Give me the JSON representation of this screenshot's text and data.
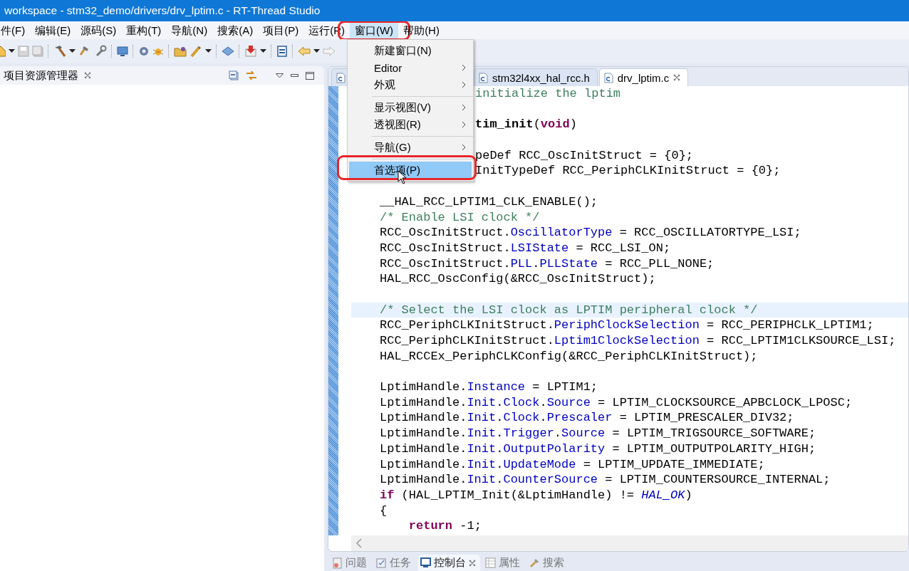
{
  "window": {
    "title": "workspace - stm32_demo/drivers/drv_lptim.c - RT-Thread Studio"
  },
  "menu_bar": [
    {
      "label": "件(F)",
      "selected": false
    },
    {
      "label": "编辑(E)",
      "selected": false
    },
    {
      "label": "源码(S)",
      "selected": false
    },
    {
      "label": "重构(T)",
      "selected": false
    },
    {
      "label": "导航(N)",
      "selected": false
    },
    {
      "label": "搜索(A)",
      "selected": false
    },
    {
      "label": "项目(P)",
      "selected": false
    },
    {
      "label": "运行(R)",
      "selected": false
    },
    {
      "label": "窗口(W)",
      "selected": true,
      "circled": true
    },
    {
      "label": "帮助(H)",
      "selected": false
    }
  ],
  "window_menu": [
    {
      "kind": "item",
      "label": "新建窗口(N)",
      "submenu": false,
      "selected": false
    },
    {
      "kind": "item",
      "label": "Editor",
      "submenu": true,
      "selected": false
    },
    {
      "kind": "item",
      "label": "外观",
      "submenu": true,
      "selected": false
    },
    {
      "kind": "separator"
    },
    {
      "kind": "item",
      "label": "显示视图(V)",
      "submenu": true,
      "selected": false
    },
    {
      "kind": "item",
      "label": "透视图(R)",
      "submenu": true,
      "selected": false
    },
    {
      "kind": "separator"
    },
    {
      "kind": "item",
      "label": "导航(G)",
      "submenu": true,
      "selected": false
    },
    {
      "kind": "separator"
    },
    {
      "kind": "item",
      "label": "首选项(P)",
      "submenu": false,
      "selected": true,
      "circled": true,
      "pointer": true
    }
  ],
  "explorer": {
    "title": "项目资源管理器"
  },
  "editor_tabs": [
    {
      "selected": false
    },
    {
      "label": "stm32l4xx_hal_rcc.h",
      "selected": false
    },
    {
      "label": "drv_lptim.c",
      "selected": true
    }
  ],
  "code_lines": [
    {
      "kind": "partial",
      "spans": [
        {
          "kind": "comment",
          "text": "initialize the lptim"
        }
      ]
    },
    {
      "kind": "blank"
    },
    {
      "kind": "partial",
      "spans": [
        {
          "kind": "bold",
          "text": "tim_init"
        },
        {
          "kind": "plain",
          "text": "("
        },
        {
          "kind": "keyword",
          "text": "void"
        },
        {
          "kind": "plain",
          "text": ")"
        }
      ]
    },
    {
      "kind": "blank"
    },
    {
      "kind": "partial",
      "spans": [
        {
          "kind": "plain",
          "text": "peDef RCC_OscInitStruct = {0};"
        }
      ]
    },
    {
      "kind": "partial",
      "spans": [
        {
          "kind": "plain",
          "text": "InitTypeDef RCC_PeriphCLKInitStruct = {0};"
        }
      ]
    },
    {
      "kind": "blank"
    },
    {
      "kind": "code",
      "spans": [
        {
          "kind": "plain",
          "text": "__HAL_RCC_LPTIM1_CLK_ENABLE();"
        }
      ]
    },
    {
      "kind": "code",
      "spans": [
        {
          "kind": "comment",
          "text": "/* Enable LSI clock */"
        }
      ]
    },
    {
      "kind": "code",
      "spans": [
        {
          "kind": "plain",
          "text": "RCC_OscInitStruct."
        },
        {
          "kind": "field",
          "text": "OscillatorType"
        },
        {
          "kind": "plain",
          "text": " = RCC_OSCILLATORTYPE_LSI;"
        }
      ]
    },
    {
      "kind": "code",
      "spans": [
        {
          "kind": "plain",
          "text": "RCC_OscInitStruct."
        },
        {
          "kind": "field",
          "text": "LSIState"
        },
        {
          "kind": "plain",
          "text": " = RCC_LSI_ON;"
        }
      ]
    },
    {
      "kind": "code",
      "spans": [
        {
          "kind": "plain",
          "text": "RCC_OscInitStruct."
        },
        {
          "kind": "field",
          "text": "PLL"
        },
        {
          "kind": "plain",
          "text": "."
        },
        {
          "kind": "field",
          "text": "PLLState"
        },
        {
          "kind": "plain",
          "text": " = RCC_PLL_NONE;"
        }
      ]
    },
    {
      "kind": "code",
      "spans": [
        {
          "kind": "plain",
          "text": "HAL_RCC_OscConfig(&RCC_OscInitStruct);"
        }
      ]
    },
    {
      "kind": "blank"
    },
    {
      "kind": "code",
      "current": true,
      "spans": [
        {
          "kind": "comment",
          "text": "/* Select the LSI clock as LPTIM peripheral clock */"
        }
      ]
    },
    {
      "kind": "code",
      "spans": [
        {
          "kind": "plain",
          "text": "RCC_PeriphCLKInitStruct."
        },
        {
          "kind": "field",
          "text": "PeriphClockSelection"
        },
        {
          "kind": "plain",
          "text": " = RCC_PERIPHCLK_LPTIM1;"
        }
      ]
    },
    {
      "kind": "code",
      "spans": [
        {
          "kind": "plain",
          "text": "RCC_PeriphCLKInitStruct."
        },
        {
          "kind": "field",
          "text": "Lptim1ClockSelection"
        },
        {
          "kind": "plain",
          "text": " = RCC_LPTIM1CLKSOURCE_LSI;"
        }
      ]
    },
    {
      "kind": "code",
      "spans": [
        {
          "kind": "plain",
          "text": "HAL_RCCEx_PeriphCLKConfig(&RCC_PeriphCLKInitStruct);"
        }
      ]
    },
    {
      "kind": "blank"
    },
    {
      "kind": "code",
      "spans": [
        {
          "kind": "plain",
          "text": "LptimHandle."
        },
        {
          "kind": "field",
          "text": "Instance"
        },
        {
          "kind": "plain",
          "text": " = LPTIM1;"
        }
      ]
    },
    {
      "kind": "code",
      "spans": [
        {
          "kind": "plain",
          "text": "LptimHandle."
        },
        {
          "kind": "field",
          "text": "Init"
        },
        {
          "kind": "plain",
          "text": "."
        },
        {
          "kind": "field",
          "text": "Clock"
        },
        {
          "kind": "plain",
          "text": "."
        },
        {
          "kind": "field",
          "text": "Source"
        },
        {
          "kind": "plain",
          "text": " = LPTIM_CLOCKSOURCE_APBCLOCK_LPOSC;"
        }
      ]
    },
    {
      "kind": "code",
      "spans": [
        {
          "kind": "plain",
          "text": "LptimHandle."
        },
        {
          "kind": "field",
          "text": "Init"
        },
        {
          "kind": "plain",
          "text": "."
        },
        {
          "kind": "field",
          "text": "Clock"
        },
        {
          "kind": "plain",
          "text": "."
        },
        {
          "kind": "field",
          "text": "Prescaler"
        },
        {
          "kind": "plain",
          "text": " = LPTIM_PRESCALER_DIV32;"
        }
      ]
    },
    {
      "kind": "code",
      "spans": [
        {
          "kind": "plain",
          "text": "LptimHandle."
        },
        {
          "kind": "field",
          "text": "Init"
        },
        {
          "kind": "plain",
          "text": "."
        },
        {
          "kind": "field",
          "text": "Trigger"
        },
        {
          "kind": "plain",
          "text": "."
        },
        {
          "kind": "field",
          "text": "Source"
        },
        {
          "kind": "plain",
          "text": " = LPTIM_TRIGSOURCE_SOFTWARE;"
        }
      ]
    },
    {
      "kind": "code",
      "spans": [
        {
          "kind": "plain",
          "text": "LptimHandle."
        },
        {
          "kind": "field",
          "text": "Init"
        },
        {
          "kind": "plain",
          "text": "."
        },
        {
          "kind": "field",
          "text": "OutputPolarity"
        },
        {
          "kind": "plain",
          "text": " = LPTIM_OUTPUTPOLARITY_HIGH;"
        }
      ]
    },
    {
      "kind": "code",
      "spans": [
        {
          "kind": "plain",
          "text": "LptimHandle."
        },
        {
          "kind": "field",
          "text": "Init"
        },
        {
          "kind": "plain",
          "text": "."
        },
        {
          "kind": "field",
          "text": "UpdateMode"
        },
        {
          "kind": "plain",
          "text": " = LPTIM_UPDATE_IMMEDIATE;"
        }
      ]
    },
    {
      "kind": "code",
      "spans": [
        {
          "kind": "plain",
          "text": "LptimHandle."
        },
        {
          "kind": "field",
          "text": "Init"
        },
        {
          "kind": "plain",
          "text": "."
        },
        {
          "kind": "field",
          "text": "CounterSource"
        },
        {
          "kind": "plain",
          "text": " = LPTIM_COUNTERSOURCE_INTERNAL;"
        }
      ]
    },
    {
      "kind": "code",
      "spans": [
        {
          "kind": "keyword",
          "text": "if"
        },
        {
          "kind": "plain",
          "text": " (HAL_LPTIM_Init(&LptimHandle) != "
        },
        {
          "kind": "constant",
          "text": "HAL_OK"
        },
        {
          "kind": "plain",
          "text": ")"
        }
      ]
    },
    {
      "kind": "code",
      "spans": [
        {
          "kind": "plain",
          "text": "{"
        }
      ]
    },
    {
      "kind": "code",
      "spans": [
        {
          "kind": "keyword",
          "text": "    return"
        },
        {
          "kind": "plain",
          "text": " -1;"
        }
      ]
    }
  ],
  "bottom_tabs": [
    {
      "label": "问题",
      "selected": false
    },
    {
      "label": "任务",
      "selected": false
    },
    {
      "label": "控制台",
      "selected": true
    },
    {
      "label": "属性",
      "selected": false
    },
    {
      "label": "搜索",
      "selected": false
    }
  ]
}
